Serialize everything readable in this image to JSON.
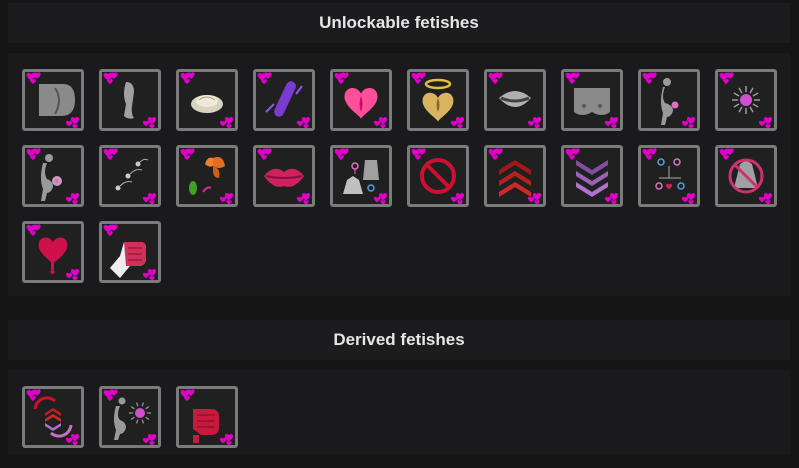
{
  "unlockable": {
    "title": "Unlockable fetishes",
    "items": [
      {
        "icon": "rear-icon"
      },
      {
        "icon": "leg-icon"
      },
      {
        "icon": "dish-icon"
      },
      {
        "icon": "vibrator-icon"
      },
      {
        "icon": "heart-crotch-icon"
      },
      {
        "icon": "halo-crotch-icon"
      },
      {
        "icon": "mouth-icon"
      },
      {
        "icon": "breasts-icon"
      },
      {
        "icon": "pregnant-silhouette-icon"
      },
      {
        "icon": "starburst-icon"
      },
      {
        "icon": "pregnancy-egg-icon"
      },
      {
        "icon": "sperm-icon"
      },
      {
        "icon": "butterfly-cocoon-icon"
      },
      {
        "icon": "lips-icon"
      },
      {
        "icon": "crossdress-icon"
      },
      {
        "icon": "prohibited-icon"
      },
      {
        "icon": "chevrons-up-icon"
      },
      {
        "icon": "chevrons-down-icon"
      },
      {
        "icon": "gender-tree-icon"
      },
      {
        "icon": "no-dress-icon"
      },
      {
        "icon": "bleeding-heart-icon"
      },
      {
        "icon": "fist-icon"
      }
    ]
  },
  "derived": {
    "title": "Derived fetishes",
    "items": [
      {
        "icon": "switch-chevrons-icon"
      },
      {
        "icon": "pregnant-starburst-icon"
      },
      {
        "icon": "bleeding-fist-icon"
      }
    ]
  },
  "colors": {
    "heart": "#e000c8",
    "border": "#7b7b7b",
    "red": "#cc1030",
    "purple": "#b070d0"
  }
}
